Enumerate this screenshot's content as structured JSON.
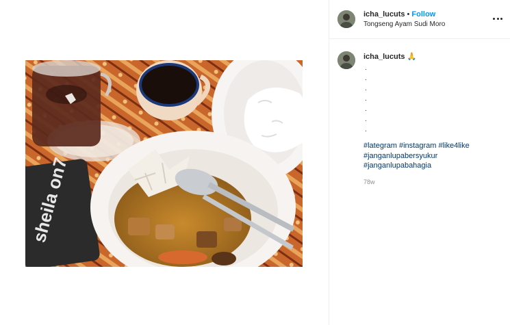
{
  "post": {
    "image_alt": "Tongseng ayam with rice, tea and coffee on a batik tablecloth",
    "phone_sticker_text": "sheila on7"
  },
  "header": {
    "username": "icha_lucuts",
    "separator": "•",
    "follow_label": "Follow",
    "location": "Tongseng Ayam Sudi Moro",
    "more_icon": "more-horizontal-icon"
  },
  "caption": {
    "username": "icha_lucuts",
    "emoji": "🙏",
    "dot_lines": [
      ".",
      ".",
      ".",
      ".",
      ".",
      ".",
      "."
    ],
    "hashtag_lines": [
      [
        "#lategram",
        "#instagram",
        "#like4like"
      ],
      [
        "#janganlupabersyukur"
      ],
      [
        "#janganlupabahagia"
      ]
    ],
    "time": "78w"
  },
  "colors": {
    "follow_blue": "#0095f6",
    "hashtag_blue": "#00376b",
    "muted_gray": "#8e8e8e",
    "divider": "#efefef"
  }
}
